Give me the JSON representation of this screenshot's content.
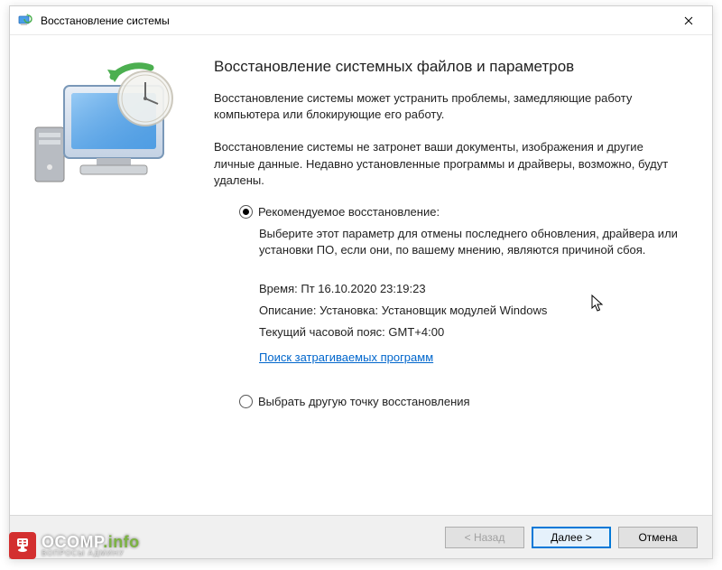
{
  "window": {
    "title": "Восстановление системы"
  },
  "content": {
    "heading": "Восстановление системных файлов и параметров",
    "para1": "Восстановление системы может устранить проблемы, замедляющие работу компьютера или блокирующие его работу.",
    "para2": "Восстановление системы не затронет ваши документы, изображения и другие личные данные. Недавно установленные программы и драйверы, возможно, будут удалены."
  },
  "options": {
    "recommended": {
      "label": "Рекомендуемое восстановление:",
      "description": "Выберите этот параметр для отмены последнего обновления, драйвера или установки ПО, если они, по вашему мнению, являются причиной сбоя.",
      "time_label": "Время:",
      "time_value": "Пт 16.10.2020 23:19:23",
      "desc_label": "Описание:",
      "desc_value": "Установка: Установщик модулей Windows",
      "tz_label": "Текущий часовой пояс:",
      "tz_value": "GMT+4:00",
      "link": "Поиск затрагиваемых программ"
    },
    "choose_other": {
      "label": "Выбрать другую точку восстановления"
    }
  },
  "footer": {
    "back": "< Назад",
    "next": "Далее >",
    "cancel": "Отмена"
  },
  "watermark": {
    "brand_main": "OCOMP",
    "brand_suffix": ".info",
    "subtitle": "ВОПРОСЫ АДМИНУ"
  }
}
